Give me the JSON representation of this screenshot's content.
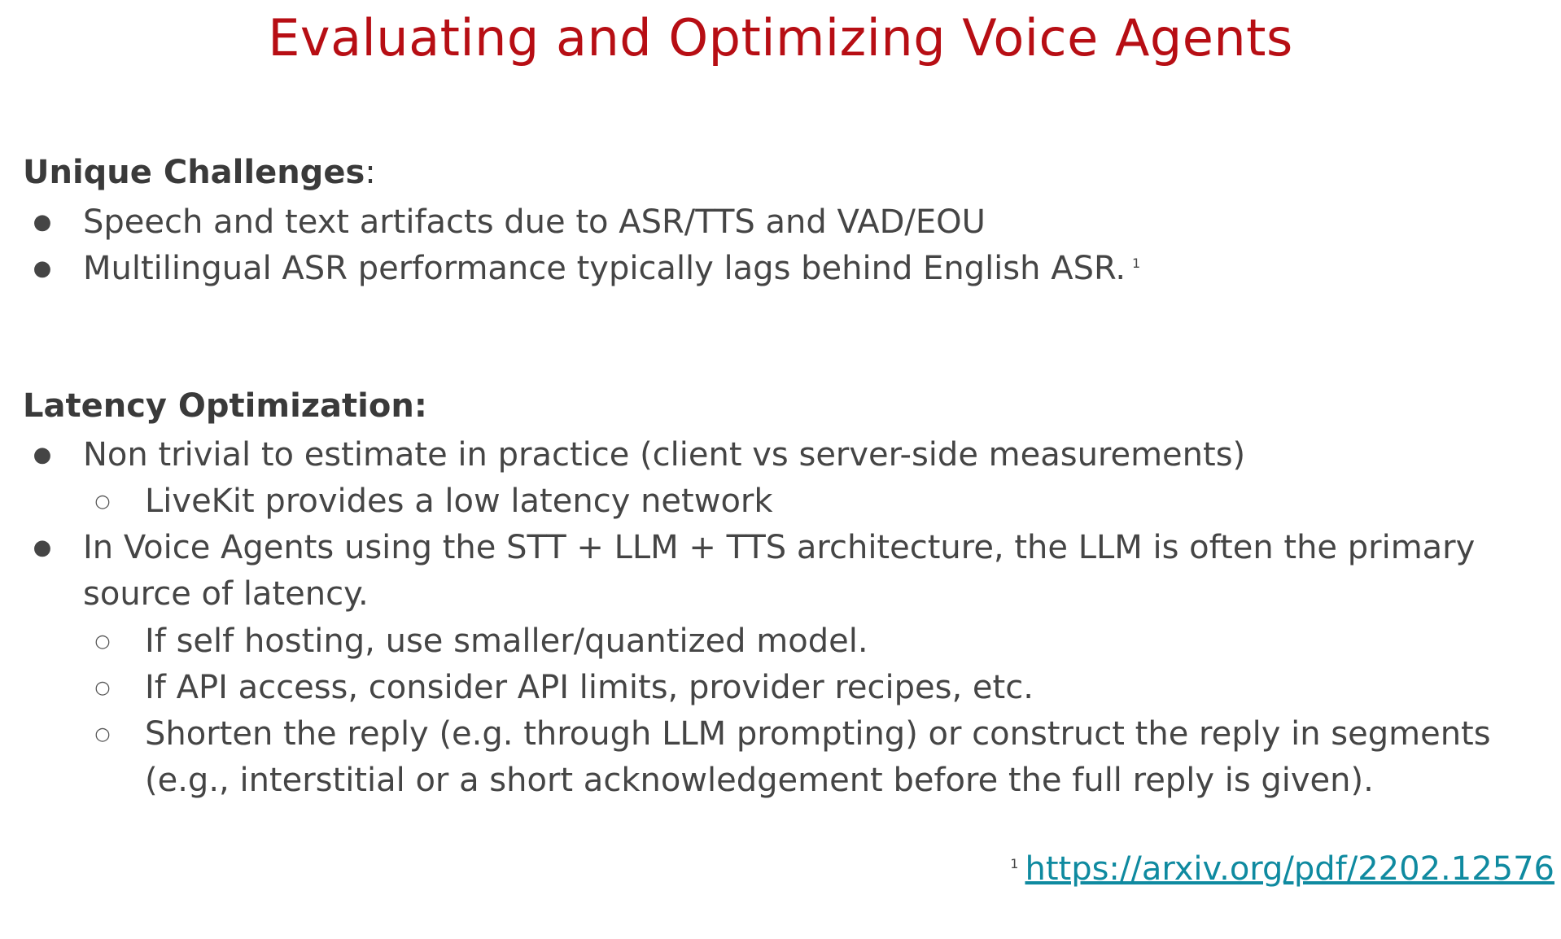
{
  "slide": {
    "title": "Evaluating and Optimizing Voice Agents",
    "title_color": "#b70e14",
    "link_color": "#0f8aa0"
  },
  "sections": {
    "challenges": {
      "heading": "Unique Challenges",
      "heading_suffix": ":",
      "bullets": [
        {
          "marker": "●",
          "text": "Speech and text artifacts due to ASR/TTS and VAD/EOU"
        },
        {
          "marker": "●",
          "text": "Multilingual ASR performance typically lags behind English ASR.",
          "footnote_ref": "1"
        }
      ]
    },
    "latency": {
      "heading": "Latency Optimization:",
      "bullets": [
        {
          "marker": "●",
          "text": "Non trivial to estimate in practice (client vs server-side measurements)"
        },
        {
          "marker": "○",
          "text": "LiveKit provides a low latency network"
        },
        {
          "marker": "●",
          "text": "In Voice Agents using the STT + LLM + TTS architecture, the LLM is often the primary source of latency."
        },
        {
          "marker": "○",
          "text": "If self hosting, use smaller/quantized model."
        },
        {
          "marker": "○",
          "text": "If API access, consider API limits, provider recipes, etc."
        },
        {
          "marker": "○",
          "text": "Shorten the reply (e.g.  through LLM prompting) or construct the reply in segments (e.g., interstitial or a short acknowledgement before the full reply is given)."
        }
      ]
    }
  },
  "footnote": {
    "ref": "1",
    "link_text": "https://arxiv.org/pdf/2202.12576"
  }
}
